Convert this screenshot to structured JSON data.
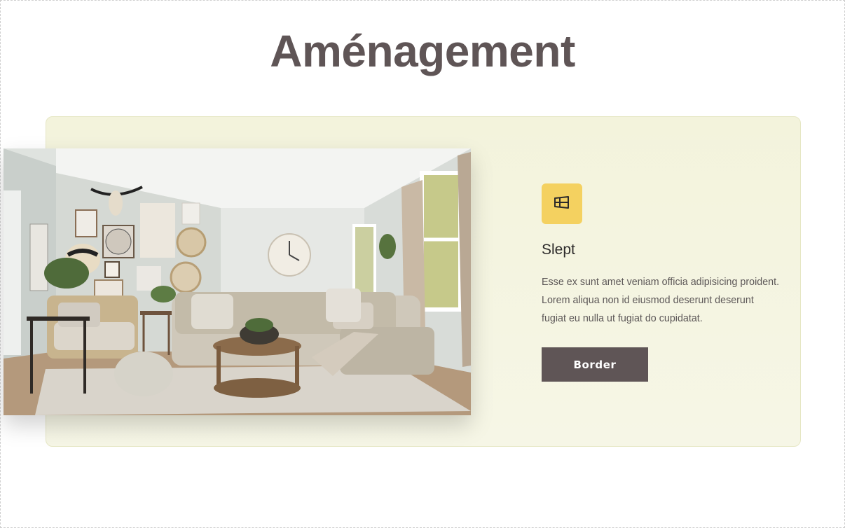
{
  "header": {
    "title": "Aménagement"
  },
  "feature": {
    "icon": "panel-icon",
    "title": "Slept",
    "description": "Esse ex sunt amet veniam officia adipisicing proident. Lorem aliqua non id eiusmod deserunt deserunt fugiat eu nulla ut fugiat do cupidatat.",
    "button_label": "Border"
  },
  "image": {
    "subject": "living room interior"
  },
  "colors": {
    "title": "#5f5556",
    "panel_bg": "#f3f3dc",
    "icon_bg": "#f4d160",
    "button_bg": "#5f5556"
  }
}
